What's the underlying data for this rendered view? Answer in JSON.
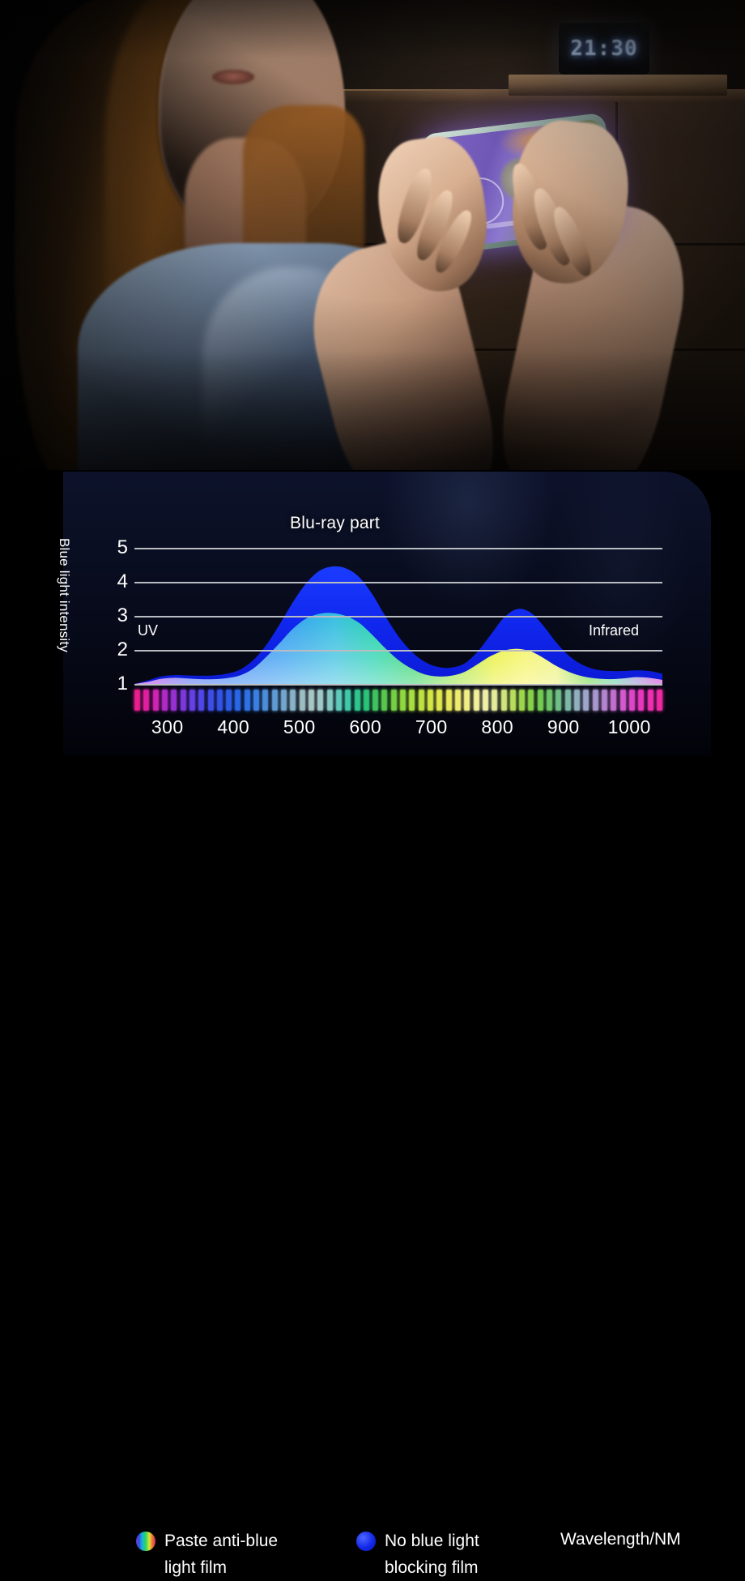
{
  "photo": {
    "scene_description": "Woman lying in dim bedroom playing a game on a smartphone at night",
    "clock_time": "21:30",
    "clock_name": "digital-alarm-clock"
  },
  "chart_panel": {
    "title": "Blu-ray part",
    "y_axis_caption": "Blue light intensity",
    "x_axis_caption": "Wavelength/NM",
    "zone_left": "UV",
    "zone_right": "Infrared"
  },
  "legend": [
    {
      "label_line1": "Paste anti-blue",
      "label_line2": "light film",
      "marker": "rainbow-dot",
      "color": "#3ad07a"
    },
    {
      "label_line1": "No blue light",
      "label_line2": "blocking film",
      "marker": "blue-dot",
      "color": "#1228e8"
    }
  ],
  "chart_data": {
    "type": "area",
    "title": "Blu-ray part",
    "xlabel": "Wavelength/NM",
    "ylabel": "Blue light intensity",
    "xlim": [
      250,
      1050
    ],
    "ylim": [
      1,
      5
    ],
    "grid": true,
    "legend_position": "bottom",
    "xticks": [
      300,
      400,
      500,
      600,
      700,
      800,
      900,
      1000
    ],
    "yticks": [
      1,
      2,
      3,
      4,
      5
    ],
    "annotations": [
      {
        "text": "UV",
        "x": 280,
        "y": 2.4
      },
      {
        "text": "Infrared",
        "x": 930,
        "y": 2.4
      },
      {
        "text": "Blu-ray part",
        "x": 560,
        "y": 5.6
      }
    ],
    "x": [
      250,
      270,
      290,
      310,
      330,
      350,
      370,
      390,
      410,
      430,
      450,
      470,
      490,
      510,
      530,
      550,
      570,
      590,
      610,
      630,
      650,
      670,
      690,
      710,
      730,
      750,
      770,
      790,
      810,
      830,
      850,
      870,
      890,
      910,
      930,
      950,
      970,
      990,
      1010,
      1030,
      1050
    ],
    "series": [
      {
        "name": "No blue light blocking film",
        "color": "#1228e8",
        "values": [
          1.0,
          1.1,
          1.22,
          1.26,
          1.25,
          1.24,
          1.25,
          1.3,
          1.42,
          1.7,
          2.15,
          2.75,
          3.4,
          3.95,
          4.32,
          4.45,
          4.4,
          4.15,
          3.65,
          3.0,
          2.4,
          1.95,
          1.65,
          1.5,
          1.48,
          1.6,
          1.95,
          2.45,
          2.95,
          3.2,
          3.1,
          2.7,
          2.2,
          1.8,
          1.55,
          1.42,
          1.38,
          1.38,
          1.4,
          1.38,
          1.3
        ]
      },
      {
        "name": "Paste anti-blue light film",
        "color": "rainbow",
        "values": [
          1.0,
          1.06,
          1.15,
          1.18,
          1.16,
          1.14,
          1.14,
          1.17,
          1.25,
          1.45,
          1.8,
          2.2,
          2.62,
          2.92,
          3.06,
          3.08,
          3.0,
          2.8,
          2.45,
          2.05,
          1.7,
          1.45,
          1.28,
          1.22,
          1.24,
          1.35,
          1.58,
          1.82,
          1.98,
          2.03,
          1.96,
          1.76,
          1.52,
          1.34,
          1.22,
          1.16,
          1.14,
          1.16,
          1.2,
          1.18,
          1.12
        ]
      }
    ]
  },
  "spectrum_bar": {
    "name": "wavelength-color-strip",
    "colors": [
      "#e81f8e",
      "#e01fa0",
      "#cf23b4",
      "#b229c6",
      "#9730d2",
      "#7c38dc",
      "#6540e4",
      "#5146e8",
      "#3f4ce8",
      "#3353e6",
      "#2c5ce6",
      "#2a66e8",
      "#2f72e6",
      "#3a80e2",
      "#4a8ddb",
      "#5e9ad4",
      "#73a6cc",
      "#88b2c6",
      "#9cbdc2",
      "#a8c6c4",
      "#9fc9c8",
      "#84c9c4",
      "#5fc9bb",
      "#3fc9a8",
      "#2ec68e",
      "#2cc277",
      "#3ec35f",
      "#57c84c",
      "#74d043",
      "#8fd83f",
      "#a8de3e",
      "#bfe240",
      "#d2e644",
      "#e0e84c",
      "#e9e95a",
      "#efeb6e",
      "#f2ee86",
      "#f3f09c",
      "#eff0a8",
      "#e3eb9a",
      "#cfe47a",
      "#b6dd5c",
      "#9cd64c",
      "#86d04a",
      "#74cb52",
      "#6cc668",
      "#70bf86",
      "#7cb8a4",
      "#8fb0bc",
      "#9ea5c8",
      "#a896cd",
      "#b584cf",
      "#c46fd0",
      "#d25ace",
      "#de45c8",
      "#e836bf",
      "#ee2fb2",
      "#f02aa4"
    ]
  }
}
